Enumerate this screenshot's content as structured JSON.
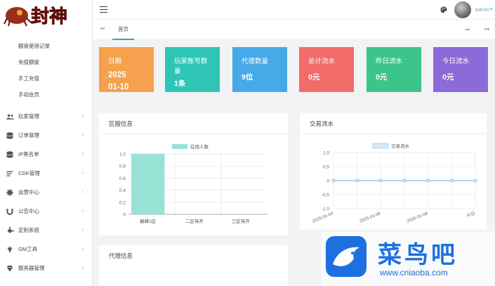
{
  "brand": {
    "logo_text": "封神"
  },
  "sidebar": {
    "sub_items": [
      {
        "label": "额度使用记录"
      },
      {
        "label": "充值额度"
      },
      {
        "label": "手工充值"
      },
      {
        "label": "手动会员"
      }
    ],
    "items": [
      {
        "label": "玩家管理",
        "icon": "users-icon"
      },
      {
        "label": "订单管理",
        "icon": "database-icon"
      },
      {
        "label": "IP黑名单",
        "icon": "database-icon"
      },
      {
        "label": "CDK管理",
        "icon": "list-icon"
      },
      {
        "label": "运营中心",
        "icon": "gear-icon"
      },
      {
        "label": "公告中心",
        "icon": "magnet-icon"
      },
      {
        "label": "定制系统",
        "icon": "puzzle-icon"
      },
      {
        "label": "GM工具",
        "icon": "bulb-icon"
      },
      {
        "label": "服务器管理",
        "icon": "diamond-icon"
      }
    ]
  },
  "header": {
    "user": "admin"
  },
  "tabs": [
    {
      "label": "首页"
    }
  ],
  "cards": [
    {
      "title": "日期",
      "value": "2025 01-10",
      "color": "#f5a14e"
    },
    {
      "title": "玩家账号数量",
      "value": "1条",
      "color": "#2ec4b6"
    },
    {
      "title": "代理数量",
      "value": "9位",
      "color": "#46a9e8"
    },
    {
      "title": "总计流水",
      "value": "0元",
      "color": "#f26b6b"
    },
    {
      "title": "昨日流水",
      "value": "0元",
      "color": "#3dc48a"
    },
    {
      "title": "今日流水",
      "value": "0元",
      "color": "#8c6ad8"
    }
  ],
  "panels": {
    "server": {
      "title": "区服信息"
    },
    "trade": {
      "title": "交易流水"
    },
    "agent": {
      "title": "代理信息"
    }
  },
  "chart_data": [
    {
      "type": "bar",
      "categories": [
        "巅峰1区",
        "二区待开",
        "三区待开"
      ],
      "series": [
        {
          "name": "在线人数",
          "values": [
            1,
            0,
            0
          ]
        }
      ],
      "yticks": [
        "0",
        "0.2",
        "0.4",
        "0.6",
        "0.8",
        "1.0"
      ],
      "ylim": [
        0,
        1
      ],
      "legend_position": "top",
      "color": "#98e2d6"
    },
    {
      "type": "line",
      "categories": [
        "2025-01-04",
        "2025-01-06",
        "2025-01-08",
        "今日"
      ],
      "point_count": 7,
      "series": [
        {
          "name": "交易流水",
          "values": [
            0,
            0,
            0,
            0,
            0,
            0,
            0
          ]
        }
      ],
      "yticks": [
        "-1.0",
        "-0.5",
        "0",
        "0.5",
        "1.0"
      ],
      "ylim": [
        -1,
        1
      ],
      "legend_position": "top",
      "color": "#9fc9e9"
    }
  ],
  "watermark": {
    "name": "菜鸟吧",
    "url": "www.cniaoba.com"
  }
}
